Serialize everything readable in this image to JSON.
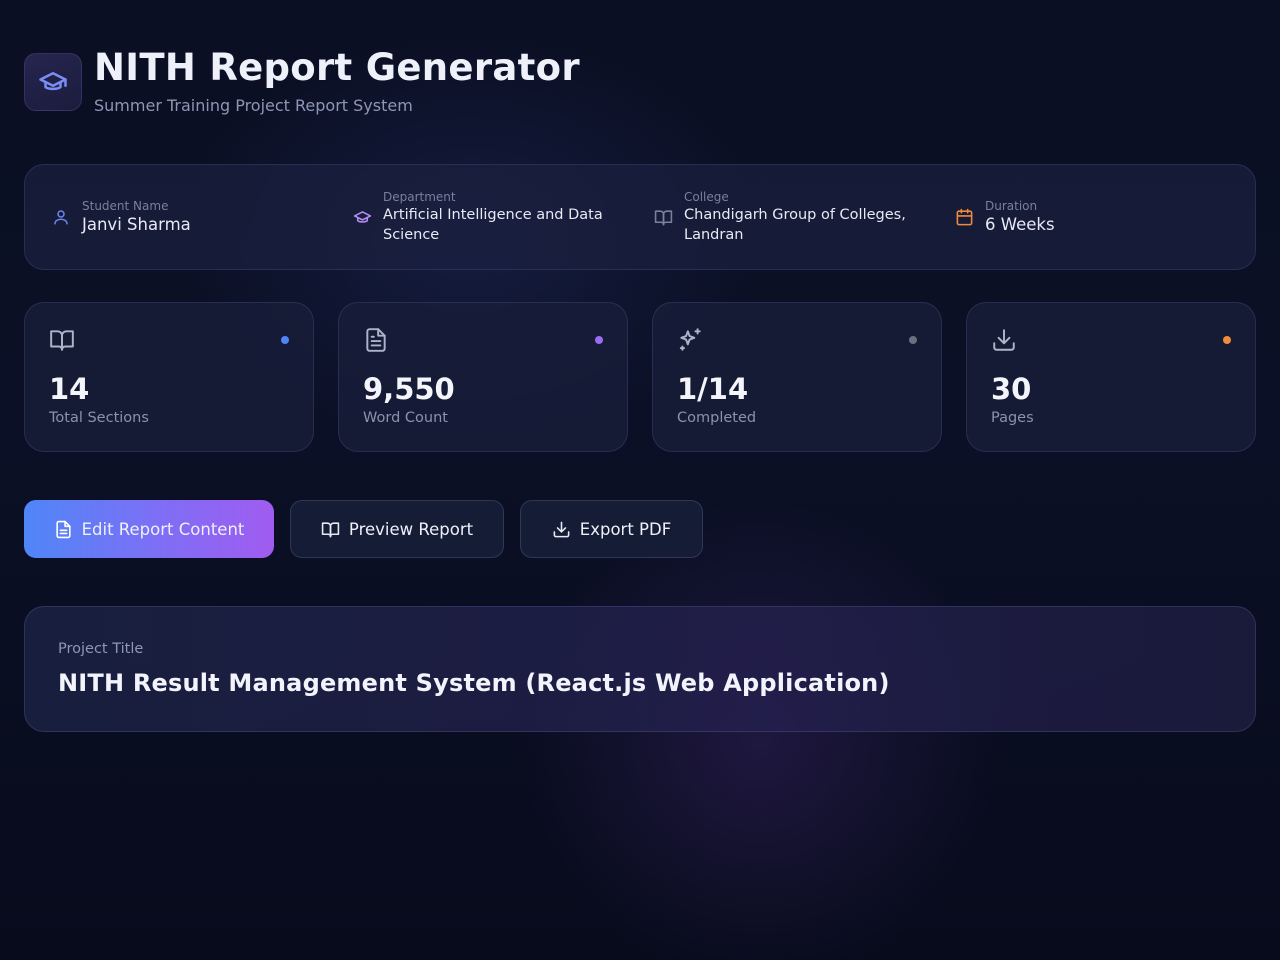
{
  "header": {
    "title": "NITH Report Generator",
    "subtitle": "Summer Training Project Report System",
    "logo_icon": "graduation-cap-icon"
  },
  "info": [
    {
      "label": "Student Name",
      "value": "Janvi Sharma",
      "icon": "user-icon",
      "color": "#6f86f0"
    },
    {
      "label": "Department",
      "value": "Artificial Intelligence and Data Science",
      "icon": "graduation-cap-icon",
      "color": "#b48cf2"
    },
    {
      "label": "College",
      "value": "Chandigarh Group of Colleges, Landran",
      "icon": "book-open-icon",
      "color": "#7b819b"
    },
    {
      "label": "Duration",
      "value": "6 Weeks",
      "icon": "calendar-icon",
      "color": "#f08a3c"
    }
  ],
  "stats": [
    {
      "value": "14",
      "label": "Total Sections",
      "icon": "book-open-icon",
      "dot_color": "#4f86f7"
    },
    {
      "value": "9,550",
      "label": "Word Count",
      "icon": "file-text-icon",
      "dot_color": "#9b6cf0"
    },
    {
      "value": "1/14",
      "label": "Completed",
      "icon": "sparkles-icon",
      "dot_color": "#6b7080"
    },
    {
      "value": "30",
      "label": "Pages",
      "icon": "download-icon",
      "dot_color": "#f08a3c"
    }
  ],
  "actions": {
    "edit_label": "Edit Report Content",
    "preview_label": "Preview Report",
    "export_label": "Export PDF"
  },
  "project": {
    "label": "Project Title",
    "title": "NITH Result Management System (React.js Web Application)"
  }
}
